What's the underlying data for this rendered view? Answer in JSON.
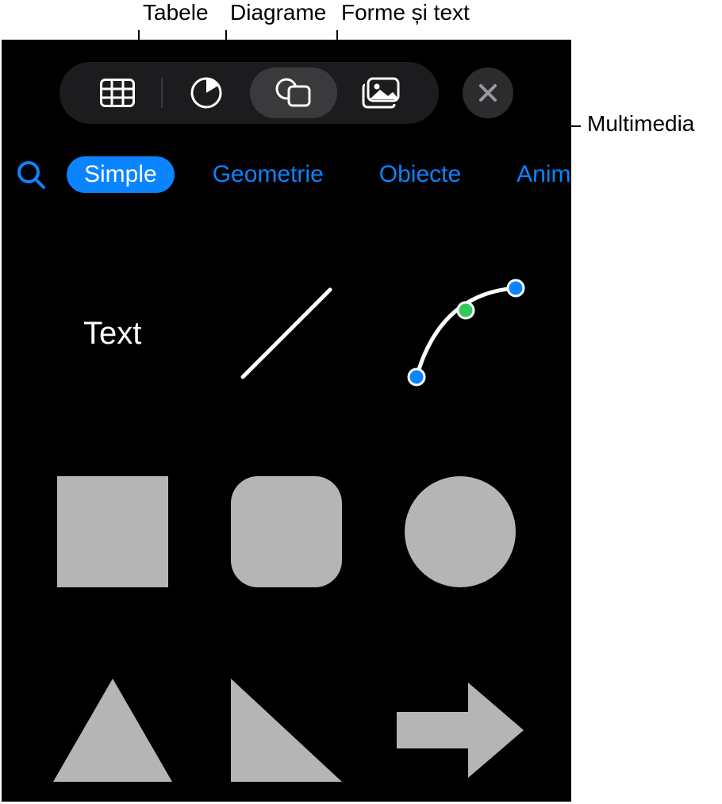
{
  "callouts": {
    "tables": "Tabele",
    "charts": "Diagrame",
    "shapes_text": "Forme și text",
    "media": "Multimedia"
  },
  "toolbar": {
    "icons": [
      "table-icon",
      "chart-icon",
      "shape-icon",
      "media-icon"
    ],
    "selected_index": 2,
    "close_icon": "close-icon"
  },
  "tabs": {
    "search_icon": "search-icon",
    "items": [
      "Simple",
      "Geometrie",
      "Obiecte",
      "Animale"
    ],
    "active_index": 0
  },
  "shapes": {
    "row1": {
      "text_label": "Text",
      "line_icon": "line-shape-icon",
      "bezier_icon": "bezier-curve-icon"
    },
    "row2": [
      "square-shape",
      "rounded-square-shape",
      "circle-shape"
    ],
    "row3": [
      "triangle-shape",
      "right-triangle-shape",
      "arrow-right-shape"
    ]
  },
  "colors": {
    "accent": "#0a84ff",
    "shape_fill": "#b5b5b5"
  }
}
